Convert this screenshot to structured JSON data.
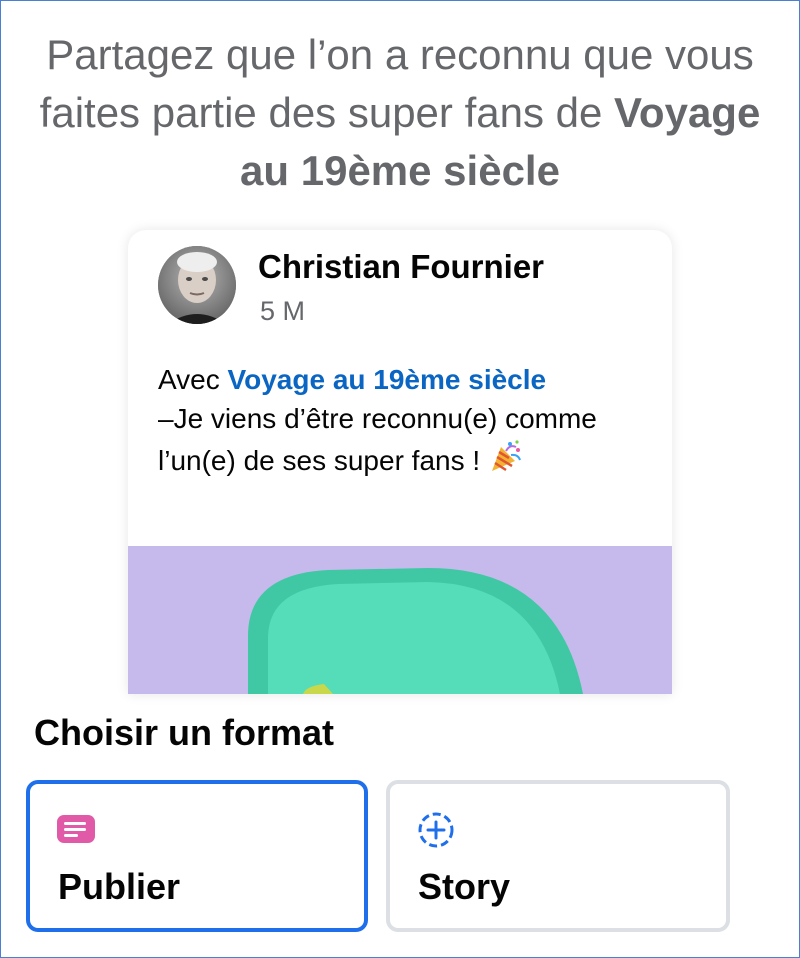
{
  "headline": {
    "prefix": "Partagez que l’on a reconnu que vous faites partie des super fans de",
    "page_name": "Voyage au 19ème siècle"
  },
  "post": {
    "author": "Christian Fournier",
    "time": "5 M",
    "text_prefix": "Avec",
    "text_link": "Voyage au 19ème siècle",
    "text_body": "–Je viens d’être reconnu(e) comme l’un(e) de ses super fans !",
    "emoji": "party-popper-icon"
  },
  "formats": {
    "title": "Choisir un format",
    "options": [
      {
        "label": "Publier",
        "icon": "post-icon",
        "selected": true
      },
      {
        "label": "Story",
        "icon": "add-story-icon",
        "selected": false
      }
    ]
  },
  "colors": {
    "accent": "#1f6feb",
    "link": "#0a66c2",
    "post_icon": "#e05aa8",
    "media_bg": "#c6b9ec",
    "media_shape": "#4fd8b4"
  }
}
